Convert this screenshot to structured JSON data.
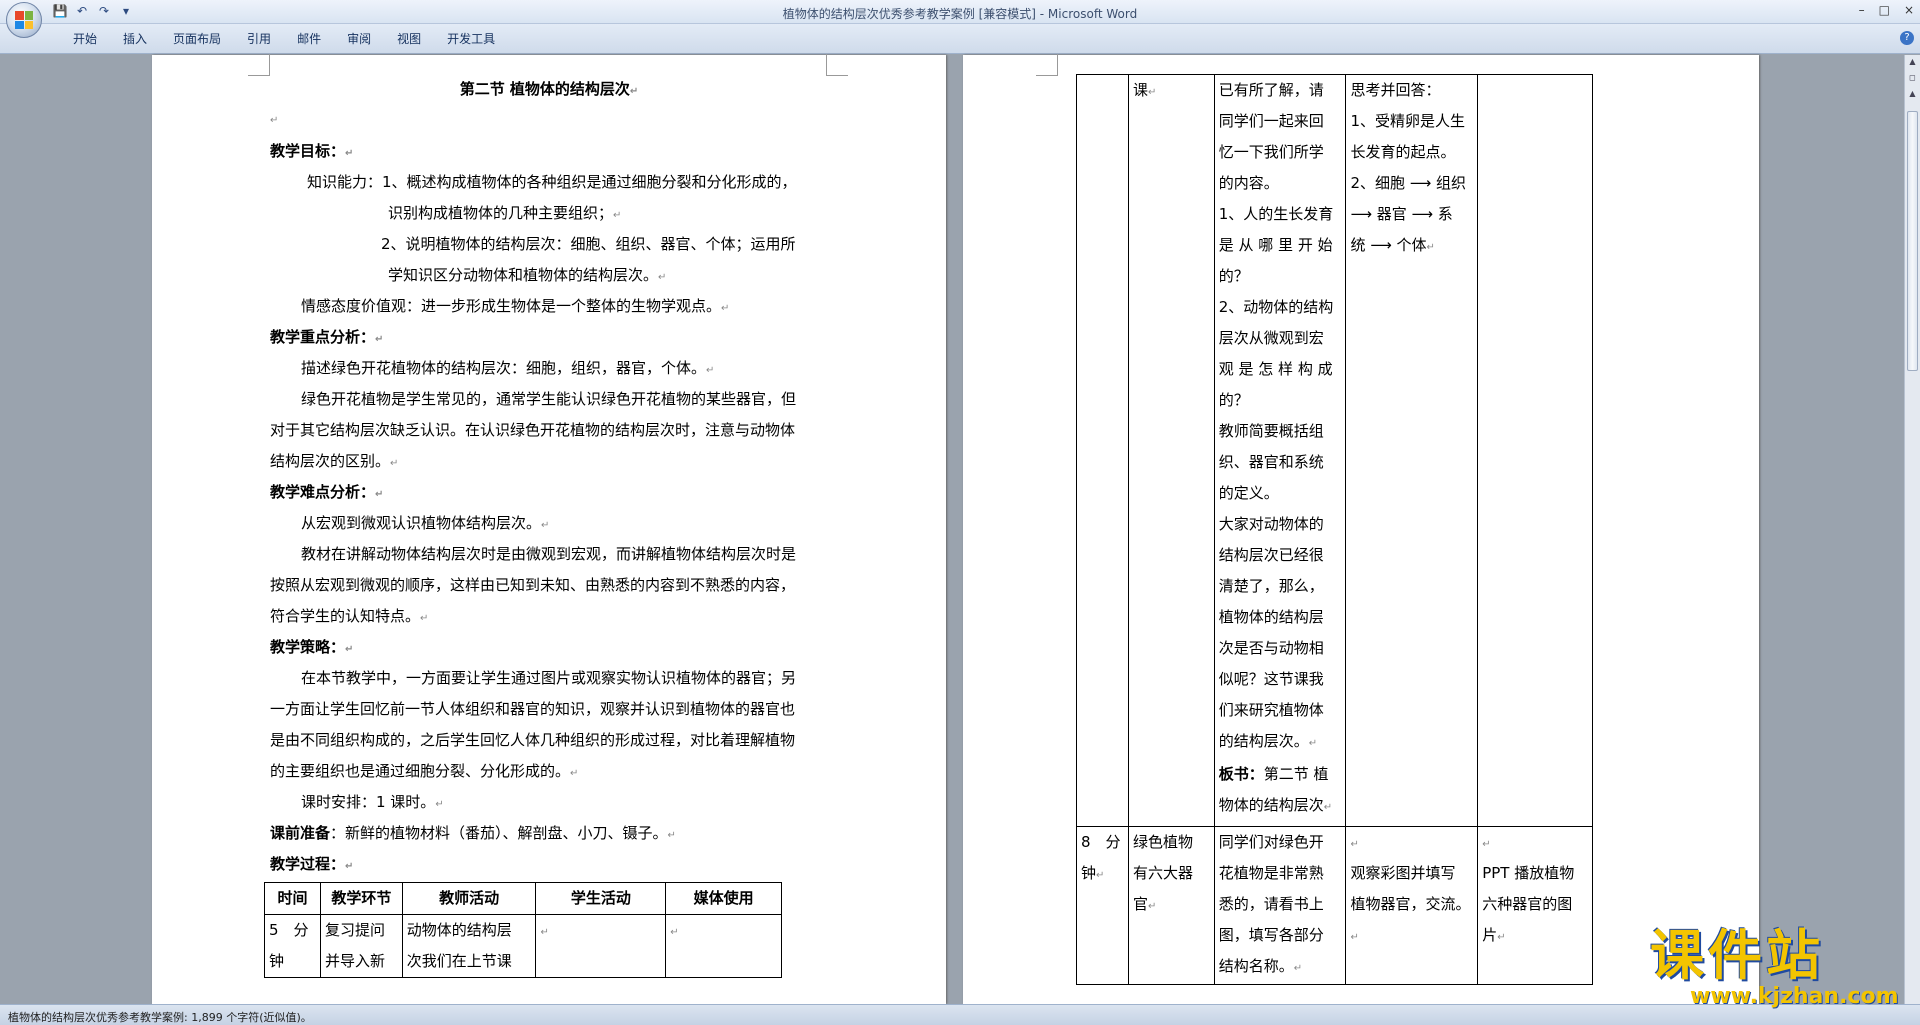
{
  "window": {
    "title": "植物体的结构层次优秀参考教学案例 [兼容模式] - Microsoft Word",
    "controls": [
      "–",
      "□",
      "×"
    ]
  },
  "qat": {
    "save": "💾",
    "undo": "↶",
    "redo": "↷",
    "more": "▾"
  },
  "ribbon": {
    "tabs": [
      "开始",
      "插入",
      "页面布局",
      "引用",
      "邮件",
      "审阅",
      "视图",
      "开发工具"
    ],
    "help": "?"
  },
  "status": {
    "text": "植物体的结构层次优秀参考教学案例: 1,899 个字符(近似值)。"
  },
  "doc": {
    "title": "第二节 植物体的结构层次",
    "goal_heading": "教学目标：",
    "goal_1a": "知识能力：1、概述构成植物体的各种组织是通过细胞分裂和分化形成的，",
    "goal_1b": "识别构成植物体的几种主要组织；",
    "goal_2a": "2、说明植物体的结构层次：细胞、组织、器官、个体；运用所",
    "goal_2b": "学知识区分动物体和植物体的结构层次。",
    "goal_3": "情感态度价值观：进一步形成生物体是一个整体的生物学观点。",
    "key_heading": "教学重点分析：",
    "key_1": "描述绿色开花植物体的结构层次：细胞，组织，器官，个体。",
    "key_2a": "绿色开花植物是学生常见的，通常学生能认识绿色开花植物的某些器官，但",
    "key_2b": "对于其它结构层次缺乏认识。在认识绿色开花植物的结构层次时，注意与动物体",
    "key_2c": "结构层次的区别。",
    "diff_heading": "教学难点分析：",
    "diff_1": "从宏观到微观认识植物体结构层次。",
    "diff_2a": "教材在讲解动物体结构层次时是由微观到宏观，而讲解植物体结构层次时是",
    "diff_2b": "按照从宏观到微观的顺序，这样由已知到未知、由熟悉的内容到不熟悉的内容，",
    "diff_2c": "符合学生的认知特点。",
    "strat_heading": "教学策略：",
    "strat_1": "在本节教学中，一方面要让学生通过图片或观察实物认识植物体的器官；另",
    "strat_2": "一方面让学生回忆前一节人体组织和器官的知识，观察并认识到植物体的器官也",
    "strat_3": "是由不同组织构成的，之后学生回忆人体几种组织的形成过程，对比着理解植物",
    "strat_4": "的主要组织也是通过细胞分裂、分化形成的。",
    "hours": "课时安排：1 课时。",
    "prep_heading": "课前准备",
    "prep_text": "：新鲜的植物材料（番茄）、解剖盘、小刀、镊子。",
    "proc_heading": "教学过程：",
    "table_head": [
      "时间",
      "教学环节",
      "教师活动",
      "学生活动",
      "媒体使用"
    ],
    "row1": {
      "time_a": "5　分",
      "time_b": "钟",
      "stage_a": "复习提问",
      "stage_b": "并导入新",
      "teacher_a": "动物体的结构层",
      "teacher_b": "次我们在上节课"
    }
  },
  "doc2": {
    "r1_stage": "课",
    "r1_teacher": [
      "已有所了解，请",
      "同学们一起来回",
      "忆一下我们所学",
      "的内容。",
      "1、人的生长发育",
      "是 从 哪 里 开 始",
      "的？",
      "2、动物体的结构",
      "层次从微观到宏",
      "观 是 怎 样 构 成",
      "的？",
      "教师简要概括组",
      "织、器官和系统",
      "的定义。",
      "大家对动物体的",
      "结构层次已经很",
      "清楚了，那么，",
      "植物体的结构层",
      "次是否与动物相",
      "似呢？这节课我",
      "们来研究植物体",
      "的结构层次。"
    ],
    "r1_board_label": "板书：",
    "r1_board_a": "第二节 植",
    "r1_board_b": "物体的结构层次",
    "r1_student": [
      "思考并回答：",
      "1、受精卵是人生",
      "长发育的起点。",
      "2、细胞 ⟶ 组织",
      "⟶ 器官 ⟶ 系",
      "统 ⟶ 个体"
    ],
    "r2_time": [
      "8　分",
      "钟"
    ],
    "r2_stage": [
      "绿色植物",
      "有六大器",
      "官"
    ],
    "r2_teacher": [
      "同学们对绿色开",
      "花植物是非常熟",
      "悉的，请看书上",
      "图，填写各部分",
      "结构名称。"
    ],
    "r2_student": [
      "",
      "观察彩图并填写",
      "植物器官，交流。"
    ],
    "r2_media": [
      "",
      "PPT 播放植物",
      "六种器官的图",
      "片"
    ]
  },
  "watermark": {
    "main": "课件站",
    "url": "www.kjzhan.com"
  }
}
